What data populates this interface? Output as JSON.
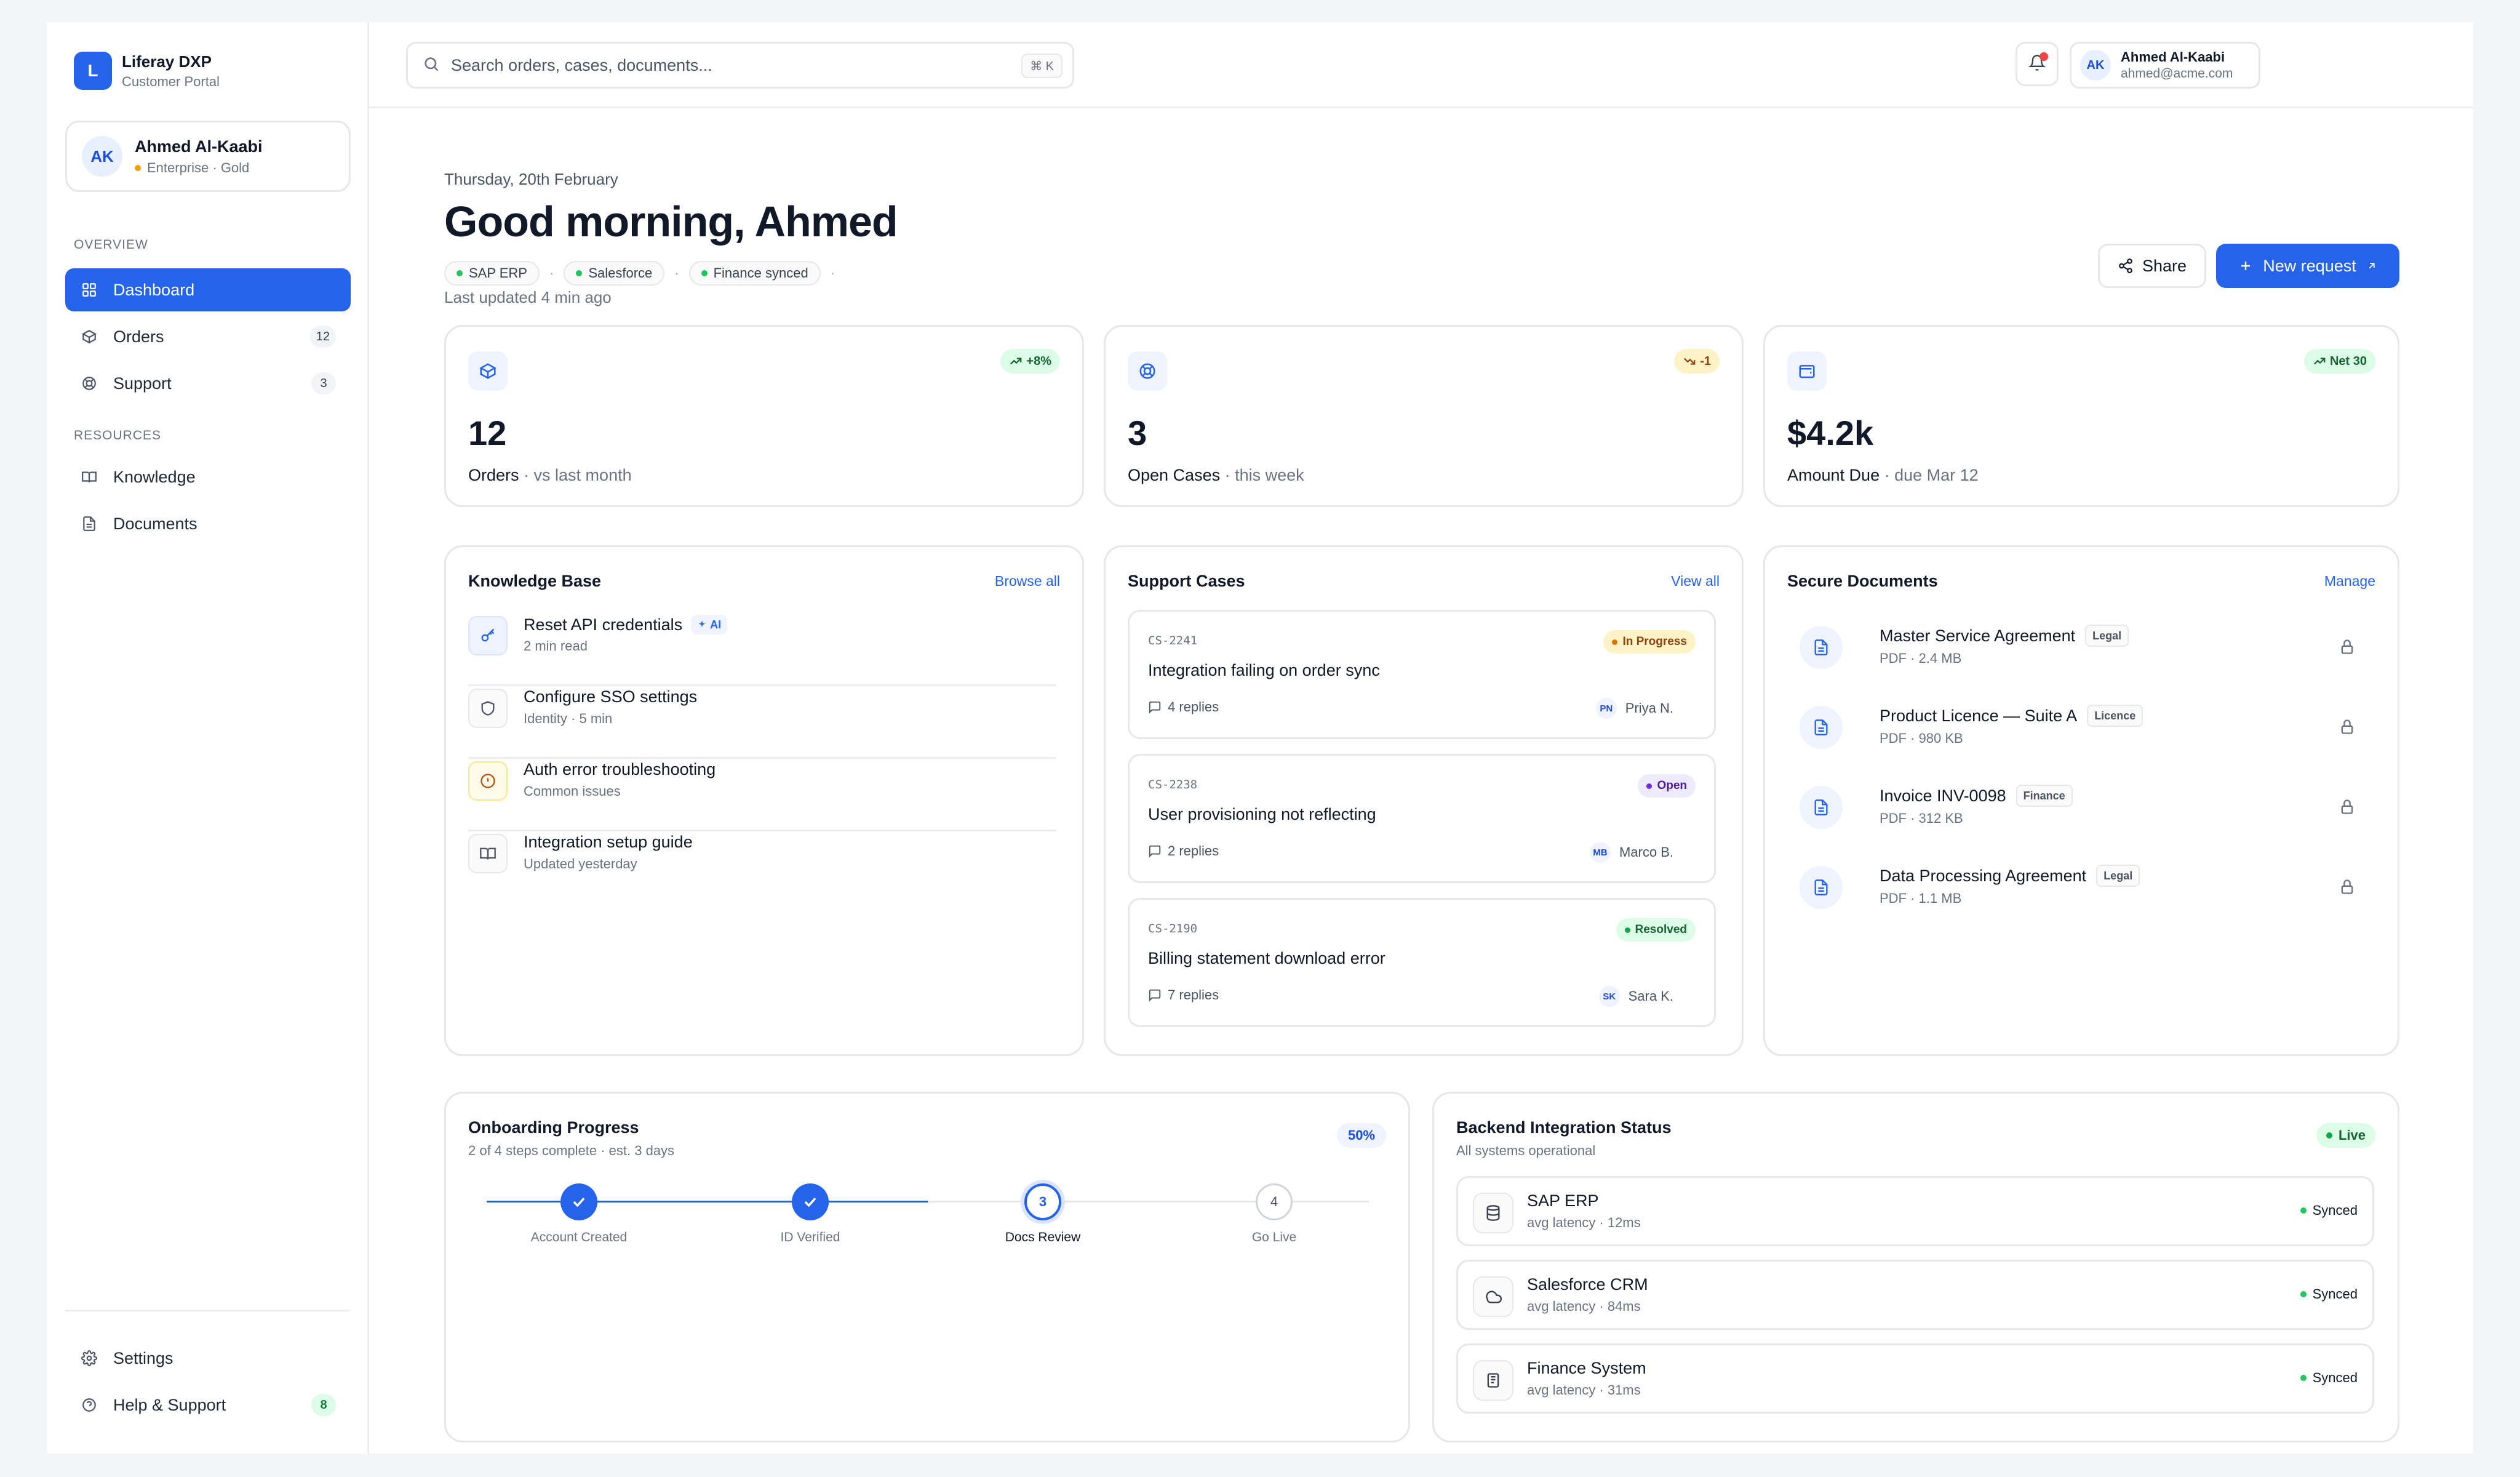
{
  "brand": {
    "logo_letter": "L",
    "name": "Liferay DXP",
    "subtitle": "Customer Portal"
  },
  "sidebar": {
    "user": {
      "initials": "AK",
      "name": "Ahmed Al-Kaabi",
      "tier": "Enterprise · Gold",
      "tier_dot_color": "#f59e0b"
    },
    "sections": {
      "overview": "OVERVIEW",
      "resources": "RESOURCES"
    },
    "items": [
      {
        "label": "Dashboard",
        "icon": "grid-icon",
        "active": true
      },
      {
        "label": "Orders",
        "icon": "box-icon",
        "badge": "12"
      },
      {
        "label": "Support",
        "icon": "lifebuoy-icon",
        "badge": "3"
      },
      {
        "label": "Knowledge",
        "icon": "book-icon"
      },
      {
        "label": "Documents",
        "icon": "file-icon"
      }
    ],
    "footer": [
      {
        "label": "Settings",
        "icon": "gear-icon"
      },
      {
        "label": "Help & Support",
        "icon": "help-icon",
        "badge": "8"
      }
    ]
  },
  "topbar": {
    "search_placeholder": "Search orders, cases, documents...",
    "shortcut": "⌘ K",
    "user": {
      "initials": "AK",
      "name": "Ahmed Al-Kaabi",
      "email": "ahmed@acme.com"
    }
  },
  "header": {
    "date": "Thursday, 20th February",
    "greeting": "Good morning, Ahmed",
    "pills": [
      "SAP ERP",
      "Salesforce",
      "Finance synced"
    ],
    "last_updated": "Last updated 4 min ago",
    "share_label": "Share",
    "new_request_label": "New request"
  },
  "stats": [
    {
      "value": "12",
      "label": "Orders",
      "sub": "· vs last month",
      "trend": "+8%",
      "trend_dir": "up"
    },
    {
      "value": "3",
      "label": "Open Cases",
      "sub": "· this week",
      "trend": "-1",
      "trend_dir": "down"
    },
    {
      "value": "$4.2k",
      "label": "Amount Due",
      "sub": "· due Mar 12",
      "trend": "Net 30",
      "trend_dir": "up"
    }
  ],
  "knowledge": {
    "title": "Knowledge Base",
    "link": "Browse all",
    "items": [
      {
        "title": "Reset API credentials",
        "sub": "2 min read",
        "tag": "AI",
        "icon": "key-icon"
      },
      {
        "title": "Configure SSO settings",
        "sub": "Identity · 5 min",
        "icon": "shield-icon"
      },
      {
        "title": "Auth error troubleshooting",
        "sub": "Common issues",
        "icon": "alert-circle-icon"
      },
      {
        "title": "Integration setup guide",
        "sub": "Updated yesterday",
        "icon": "book-open-icon"
      }
    ]
  },
  "cases": {
    "title": "Support Cases",
    "link": "View all",
    "items": [
      {
        "id": "CS-2241",
        "title": "Integration failing on order sync",
        "status": "In Progress",
        "replies": "4 replies",
        "initials": "PN",
        "assignee": "Priya N."
      },
      {
        "id": "CS-2238",
        "title": "User provisioning not reflecting",
        "status": "Open",
        "replies": "2 replies",
        "initials": "MB",
        "assignee": "Marco B."
      },
      {
        "id": "CS-2190",
        "title": "Billing statement download error",
        "status": "Resolved",
        "replies": "7 replies",
        "initials": "SK",
        "assignee": "Sara K."
      }
    ]
  },
  "documents": {
    "title": "Secure Documents",
    "link": "Manage",
    "items": [
      {
        "title": "Master Service Agreement",
        "tag": "Legal",
        "meta": "PDF · 2.4 MB"
      },
      {
        "title": "Product Licence — Suite A",
        "tag": "Licence",
        "meta": "PDF · 980 KB"
      },
      {
        "title": "Invoice INV-0098",
        "tag": "Finance",
        "meta": "PDF · 312 KB"
      },
      {
        "title": "Data Processing Agreement",
        "tag": "Legal",
        "meta": "PDF · 1.1 MB"
      }
    ]
  },
  "onboarding": {
    "title": "Onboarding Progress",
    "sub": "2 of 4 steps complete · est. 3 days",
    "percent": "50%",
    "progress_fraction": 0.5,
    "steps": [
      {
        "label": "Account Created",
        "state": "done",
        "num": "1"
      },
      {
        "label": "ID Verified",
        "state": "done",
        "num": "2"
      },
      {
        "label": "Docs Review",
        "state": "current",
        "num": "3"
      },
      {
        "label": "Go Live",
        "state": "todo",
        "num": "4"
      }
    ]
  },
  "integrations": {
    "title": "Backend Integration Status",
    "sub": "All systems operational",
    "live": "Live",
    "items": [
      {
        "name": "SAP ERP",
        "meta": "avg latency · 12ms",
        "status": "Synced",
        "icon": "database-icon"
      },
      {
        "name": "Salesforce CRM",
        "meta": "avg latency · 84ms",
        "status": "Synced",
        "icon": "cloud-icon"
      },
      {
        "name": "Finance System",
        "meta": "avg latency · 31ms",
        "status": "Synced",
        "icon": "ledger-icon"
      }
    ]
  },
  "colors": {
    "accent": "#2563eb",
    "success": "#22c55e",
    "danger": "#ef4444",
    "warning": "#f59e0b"
  }
}
